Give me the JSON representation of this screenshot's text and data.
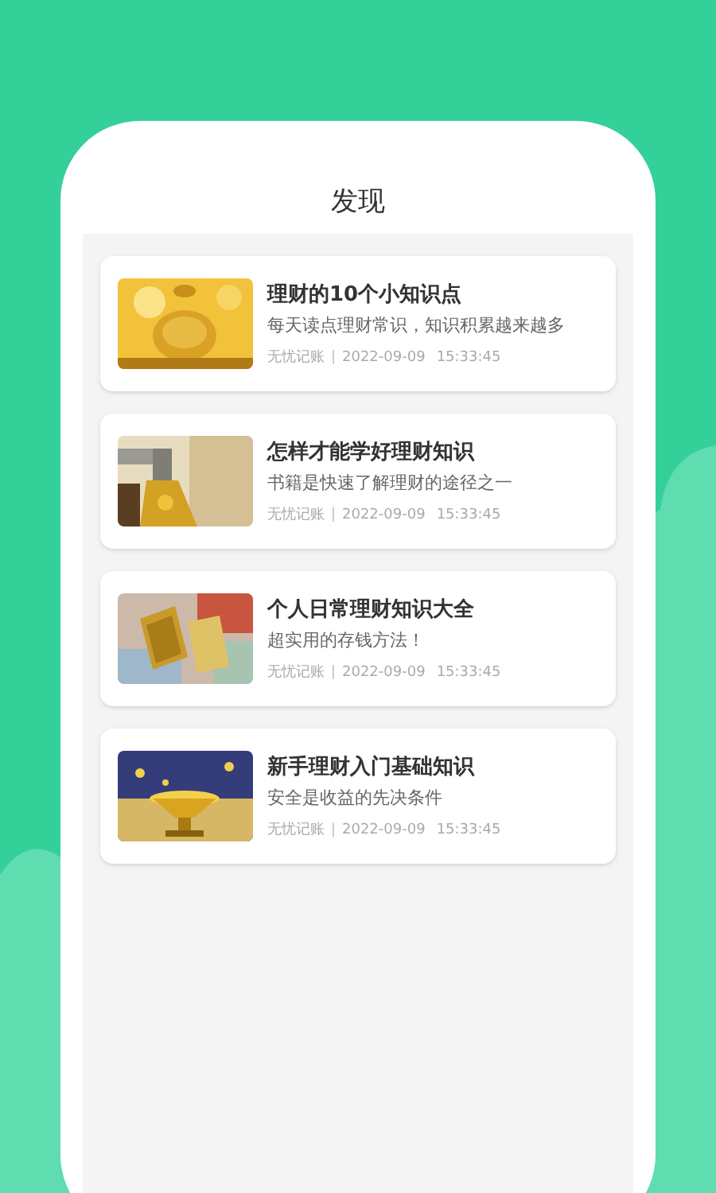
{
  "page": {
    "title": "发现"
  },
  "articles": [
    {
      "title": "理财的10个小知识点",
      "summary": "每天读点理财常识，知识积累越来越多",
      "source": "无忧记账",
      "date": "2022-09-09",
      "time": "15:33:45"
    },
    {
      "title": "怎样才能学好理财知识",
      "summary": "书籍是快速了解理财的途径之一",
      "source": "无忧记账",
      "date": "2022-09-09",
      "time": "15:33:45"
    },
    {
      "title": "个人日常理财知识大全",
      "summary": "超实用的存钱方法！",
      "source": "无忧记账",
      "date": "2022-09-09",
      "time": "15:33:45"
    },
    {
      "title": "新手理财入门基础知识",
      "summary": "安全是收益的先决条件",
      "source": "无忧记账",
      "date": "2022-09-09",
      "time": "15:33:45"
    }
  ]
}
